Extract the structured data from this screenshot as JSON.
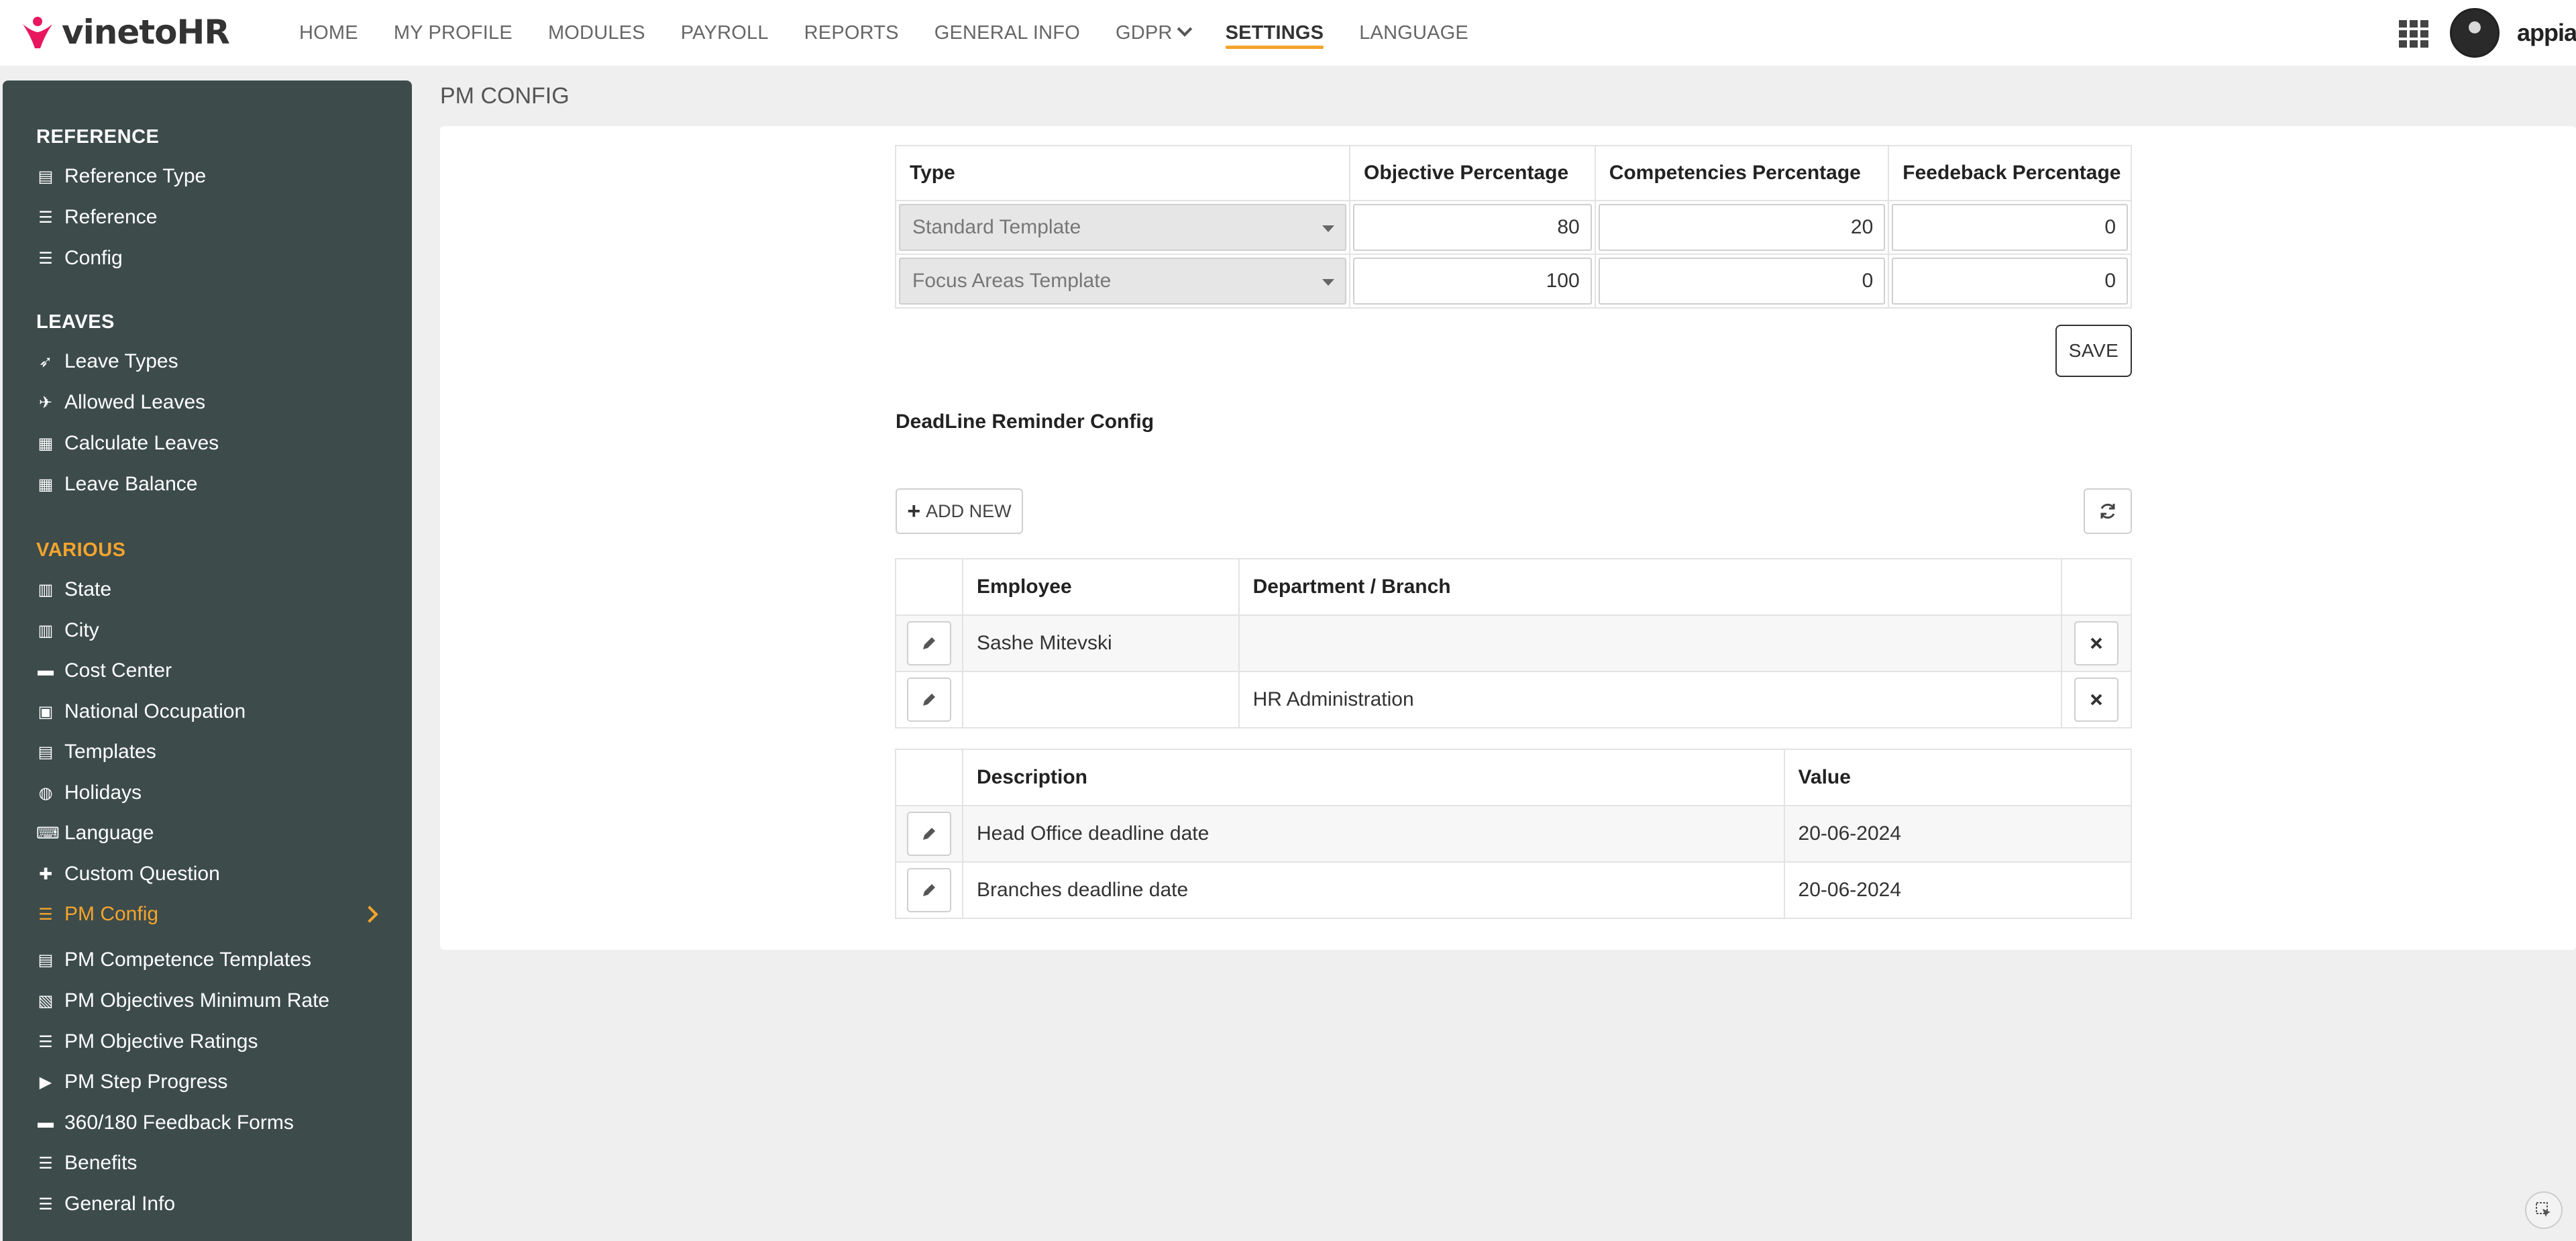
{
  "app": {
    "logo_text_main": "vineto",
    "logo_text_suffix": "HR",
    "brand_color": "#e8175d",
    "accent_color": "#f4a42c"
  },
  "nav": {
    "items": [
      {
        "label": "HOME"
      },
      {
        "label": "MY PROFILE"
      },
      {
        "label": "MODULES"
      },
      {
        "label": "PAYROLL"
      },
      {
        "label": "REPORTS"
      },
      {
        "label": "GENERAL INFO"
      },
      {
        "label": "GDPR"
      },
      {
        "label": "SETTINGS",
        "active": true
      },
      {
        "label": "LANGUAGE"
      }
    ],
    "username": "appian"
  },
  "sidebar": {
    "sections": [
      {
        "title": "REFERENCE",
        "items": [
          {
            "label": "Reference Type",
            "icon": "id-card-icon"
          },
          {
            "label": "Reference",
            "icon": "list-icon"
          },
          {
            "label": "Config",
            "icon": "list-icon"
          }
        ]
      },
      {
        "title": "LEAVES",
        "items": [
          {
            "label": "Leave Types",
            "icon": "paper-plane-icon"
          },
          {
            "label": "Allowed Leaves",
            "icon": "plane-icon"
          },
          {
            "label": "Calculate Leaves",
            "icon": "calculator-icon"
          },
          {
            "label": "Leave Balance",
            "icon": "calculator-icon"
          }
        ]
      },
      {
        "title": "VARIOUS",
        "items": [
          {
            "label": "State",
            "icon": "building-icon"
          },
          {
            "label": "City",
            "icon": "building-icon"
          },
          {
            "label": "Cost Center",
            "icon": "archive-icon"
          },
          {
            "label": "National Occupation",
            "icon": "briefcase-icon"
          },
          {
            "label": "Templates",
            "icon": "list-alt-icon"
          },
          {
            "label": "Holidays",
            "icon": "globe-icon"
          },
          {
            "label": "Language",
            "icon": "language-icon"
          },
          {
            "label": "Custom Question",
            "icon": "puzzle-icon"
          },
          {
            "label": "PM Config",
            "icon": "list-icon",
            "active": true
          },
          {
            "label": "PM Competence Templates",
            "icon": "list-alt-icon"
          },
          {
            "label": "PM Objectives Minimum Rate",
            "icon": "id-badge-icon"
          },
          {
            "label": "PM Objective Ratings",
            "icon": "list-icon"
          },
          {
            "label": "PM Step Progress",
            "icon": "step-forward-icon"
          },
          {
            "label": "360/180 Feedback Forms",
            "icon": "archive-icon"
          },
          {
            "label": "Benefits",
            "icon": "list-icon"
          },
          {
            "label": "General Info",
            "icon": "list-icon"
          }
        ]
      }
    ]
  },
  "page": {
    "title": "PM CONFIG"
  },
  "templates_table": {
    "headers": [
      "Type",
      "Objective Percentage",
      "Competencies Percentage",
      "Feedeback Percentage"
    ],
    "rows": [
      {
        "type": "Standard Template",
        "objective": "80",
        "competencies": "20",
        "feedback": "0"
      },
      {
        "type": "Focus Areas Template",
        "objective": "100",
        "competencies": "0",
        "feedback": "0"
      }
    ],
    "save_label": "SAVE"
  },
  "deadline": {
    "title": "DeadLine Reminder Config",
    "add_label": "ADD NEW",
    "emp_headers": [
      "Employee",
      "Department / Branch"
    ],
    "emp_rows": [
      {
        "employee": "Sashe Mitevski",
        "department": ""
      },
      {
        "employee": "",
        "department": "HR Administration"
      }
    ],
    "desc_headers": [
      "Description",
      "Value"
    ],
    "desc_rows": [
      {
        "description": "Head Office deadline date",
        "value": "20-06-2024"
      },
      {
        "description": "Branches deadline date",
        "value": "20-06-2024"
      }
    ]
  }
}
